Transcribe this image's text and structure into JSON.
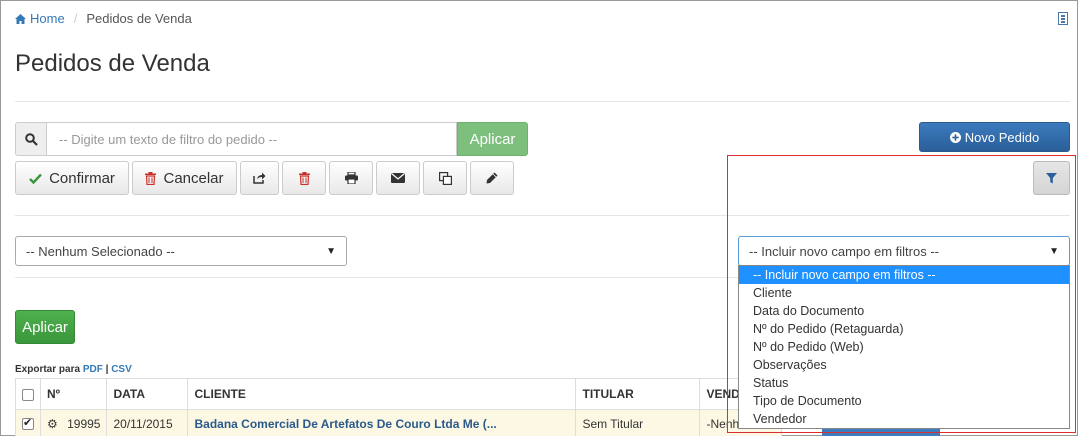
{
  "breadcrumb": {
    "home": "Home",
    "current": "Pedidos de Venda"
  },
  "page": {
    "title": "Pedidos de Venda"
  },
  "search": {
    "placeholder": "-- Digite um texto de filtro do pedido --",
    "apply": "Aplicar"
  },
  "toolbar": {
    "confirm": "Confirmar",
    "cancel": "Cancelar"
  },
  "new_order": "Novo Pedido",
  "selects": {
    "left": "-- Nenhum Selecionado --",
    "filter_field": "-- Incluir novo campo em filtros --"
  },
  "apply_button": "Aplicar",
  "export": {
    "prefix": "Exportar para",
    "pdf": "PDF",
    "sep": "|",
    "csv": "CSV"
  },
  "table": {
    "headers": [
      "Nº",
      "DATA",
      "CLIENTE",
      "TITULAR",
      "VENDEDOR"
    ],
    "rows": [
      {
        "number": "19995",
        "date": "20/11/2015",
        "client": "Badana Comercial De Artefatos De Couro Ltda Me (...",
        "holder": "Sem Titular",
        "seller": "-Nenhum"
      }
    ]
  },
  "dropdown_options": [
    "-- Incluir novo campo em filtros --",
    "Cliente",
    "Data do Documento",
    "Nº do Pedido (Retaguarda)",
    "Nº do Pedido (Web)",
    "Observações",
    "Status",
    "Tipo de Documento",
    "Vendedor"
  ],
  "dropdown_selected_index": 0,
  "colors": {
    "primary": "#2a5f99",
    "success": "#3a963a",
    "highlight": "#d9302f"
  }
}
